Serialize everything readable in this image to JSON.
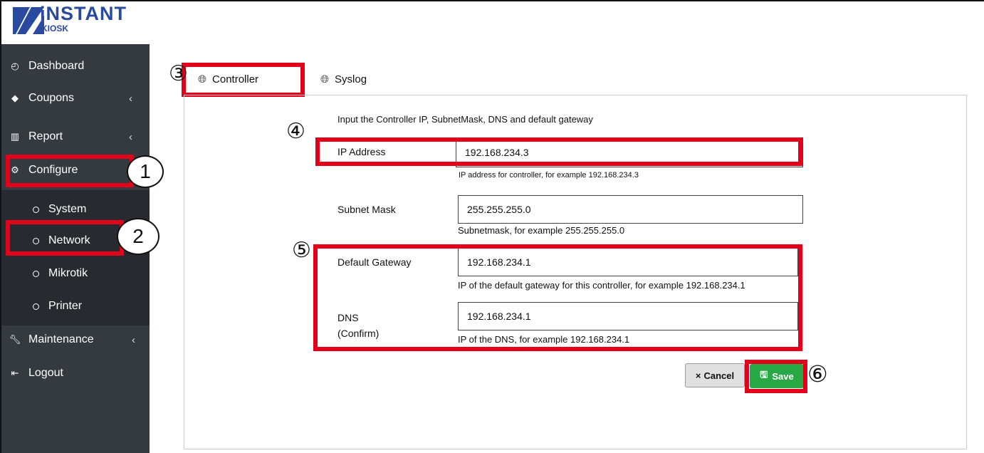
{
  "brand": {
    "name": "iNSTANT",
    "sub": "KIOSK"
  },
  "sidebar": {
    "items": [
      {
        "label": "Dashboard",
        "icon": "gauge-icon"
      },
      {
        "label": "Coupons",
        "icon": "tag-icon"
      },
      {
        "label": "Report",
        "icon": "bar-chart-icon"
      },
      {
        "label": "Configure",
        "icon": "gear-icon"
      },
      {
        "label": "Maintenance",
        "icon": "wrench-icon"
      },
      {
        "label": "Logout",
        "icon": "logout-icon"
      }
    ],
    "submenu": [
      {
        "label": "System"
      },
      {
        "label": "Network"
      },
      {
        "label": "Mikrotik"
      },
      {
        "label": "Printer"
      }
    ]
  },
  "tabs": [
    {
      "label": "Controller"
    },
    {
      "label": "Syslog"
    }
  ],
  "form": {
    "intro": "Input the Controller IP, SubnetMask, DNS and default gateway",
    "ip": {
      "label": "IP Address",
      "value": "192.168.234.3",
      "help": "IP address for controller, for example 192.168.234.3"
    },
    "subnet": {
      "label": "Subnet Mask",
      "value": "255.255.255.0",
      "help": "Subnetmask, for example 255.255.255.0"
    },
    "gateway": {
      "label": "Default Gateway",
      "value": "192.168.234.1",
      "help": "IP of the default gateway for this controller, for example 192.168.234.1"
    },
    "dns": {
      "label": "DNS",
      "label2": "(Confirm)",
      "value": "192.168.234.1",
      "help": "IP of the DNS, for example 192.168.234.1"
    }
  },
  "buttons": {
    "cancel": "Cancel",
    "save": "Save"
  },
  "annotations": [
    "1",
    "2",
    "③",
    "④",
    "⑤",
    "⑥"
  ],
  "colors": {
    "sidebar": "#343a40",
    "highlight": "#e2001a",
    "save": "#28a745",
    "brand": "#2a4aa0"
  }
}
